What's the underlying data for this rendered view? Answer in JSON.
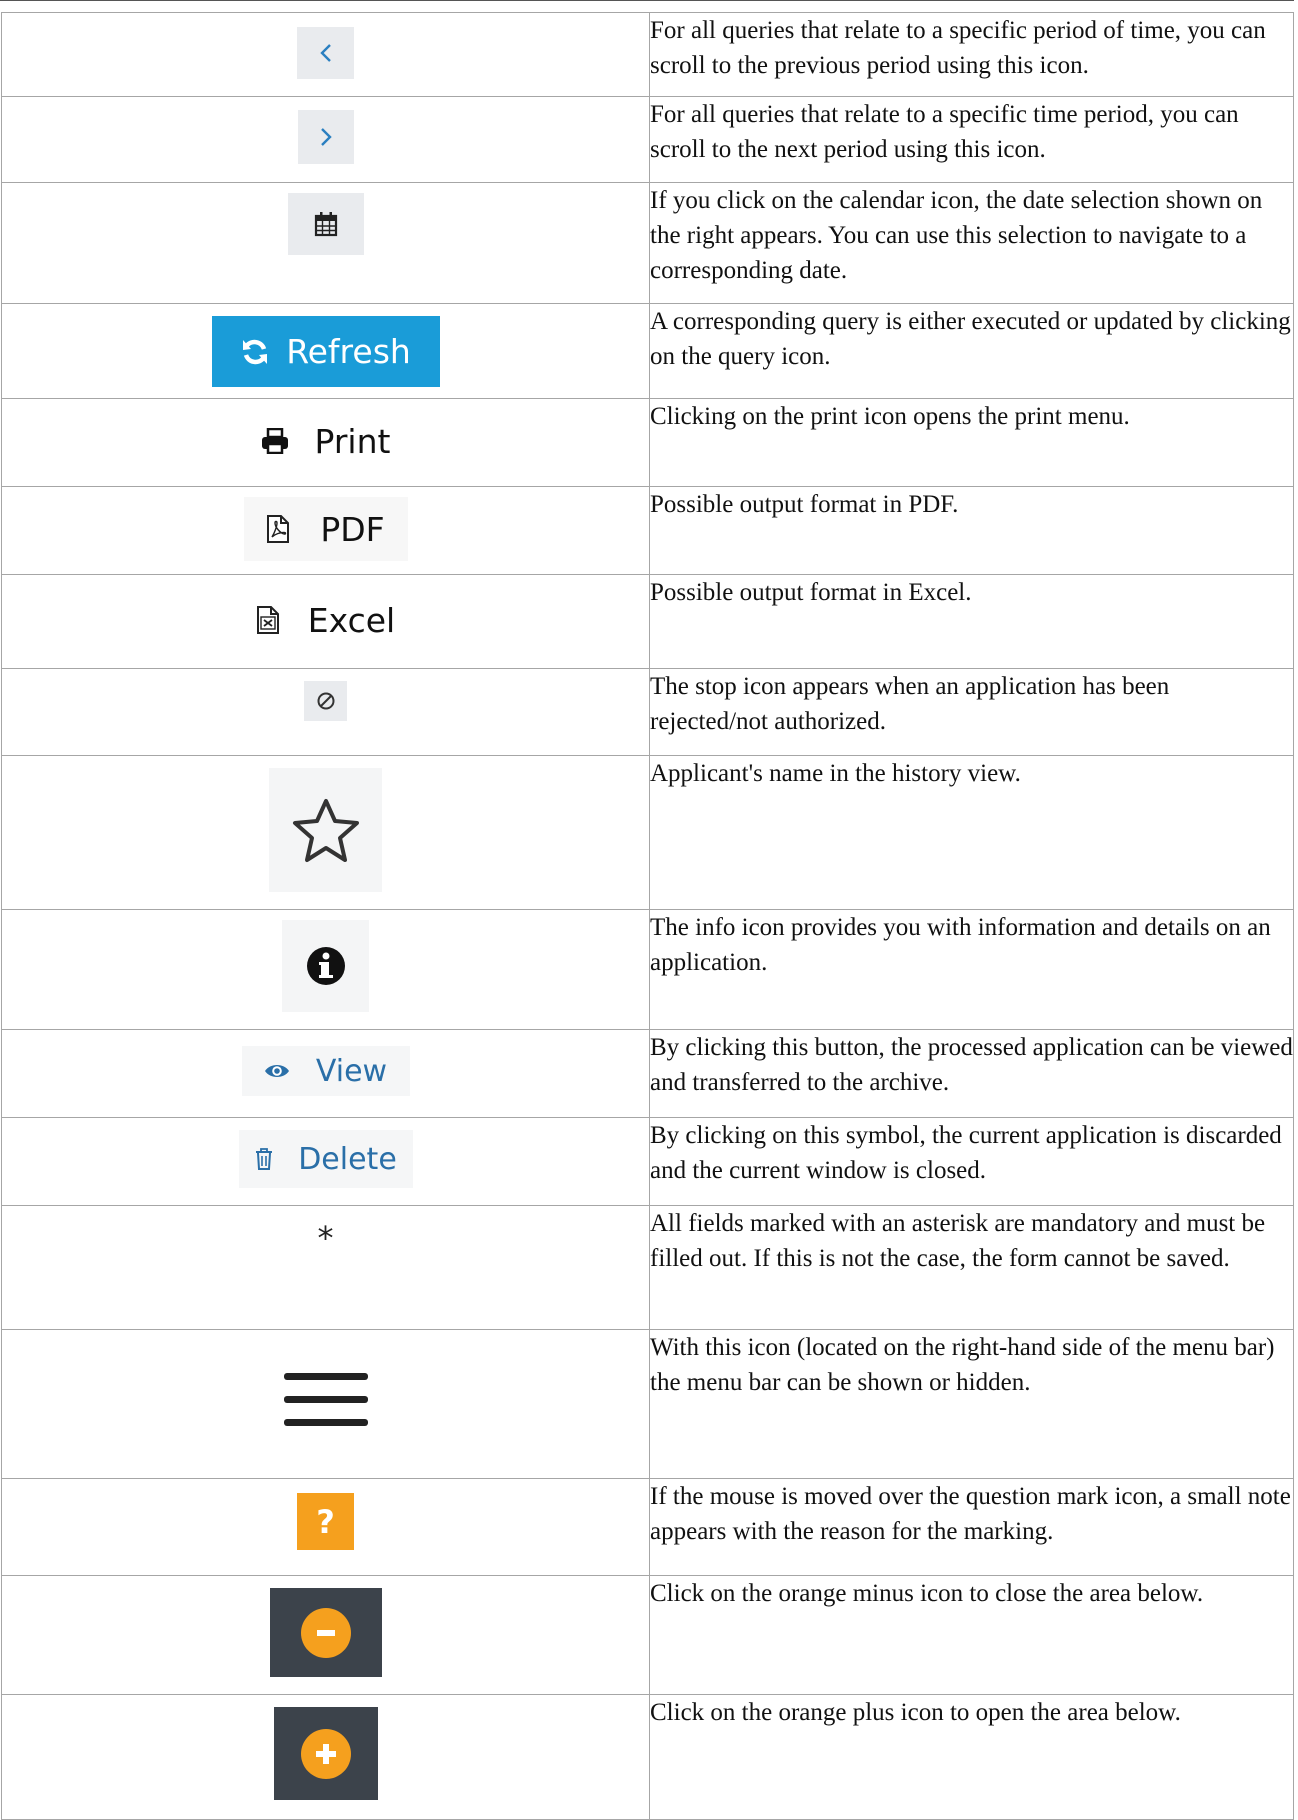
{
  "rows": [
    {
      "icon": "chevron-left-icon",
      "desc": "For all queries that relate to a specific period of time, you can scroll to the previous period using this icon."
    },
    {
      "icon": "chevron-right-icon",
      "desc": "For all queries that relate to a specific time period, you can scroll to the next period using this icon."
    },
    {
      "icon": "calendar-icon",
      "desc": "If you click on the calendar icon, the date selection shown on the right appears. You can use this selection to navigate to a corresponding date."
    },
    {
      "icon": "refresh-icon",
      "label": "Refresh",
      "desc": "A corresponding query is either executed or updated by clicking on the query icon."
    },
    {
      "icon": "print-icon",
      "label": "Print",
      "desc": "Clicking on the print icon opens the print menu."
    },
    {
      "icon": "pdf-file-icon",
      "label": "PDF",
      "desc": "Possible output format in PDF."
    },
    {
      "icon": "excel-file-icon",
      "label": "Excel",
      "desc": "Possible output format in Excel."
    },
    {
      "icon": "stop-icon",
      "desc": "The stop icon appears when an application has been rejected/not authorized."
    },
    {
      "icon": "star-icon",
      "desc": "Applicant's name in the history view."
    },
    {
      "icon": "info-icon",
      "desc": "The info icon provides you with information and details on an application."
    },
    {
      "icon": "eye-icon",
      "label": "View",
      "desc": "By clicking this button, the processed application can be viewed and transferred to the archive."
    },
    {
      "icon": "trash-icon",
      "label": "Delete",
      "desc": "By clicking on this symbol, the current application is discarded and the current window is closed."
    },
    {
      "icon": "asterisk-icon",
      "label": "*",
      "desc": "All fields marked with an asterisk are mandatory and must be filled out. If this is not the case, the form cannot be saved."
    },
    {
      "icon": "hamburger-menu-icon",
      "desc": "With this icon (located on the right-hand side of the menu bar) the menu bar can be shown or hidden."
    },
    {
      "icon": "question-mark-icon",
      "label": "?",
      "desc": "If the mouse is moved over the question mark icon, a small note appears with the reason for the marking."
    },
    {
      "icon": "minus-circle-icon",
      "desc": "Click on the orange minus icon to close the area below."
    },
    {
      "icon": "plus-circle-icon",
      "desc": "Click on the orange plus icon to open the area below."
    }
  ],
  "colors": {
    "refresh_bg": "#1a9cd8",
    "link_blue": "#2a6fa8",
    "orange": "#f5a01e",
    "dark_panel": "#3c434b",
    "icon_box_gray": "#e9ebee"
  }
}
